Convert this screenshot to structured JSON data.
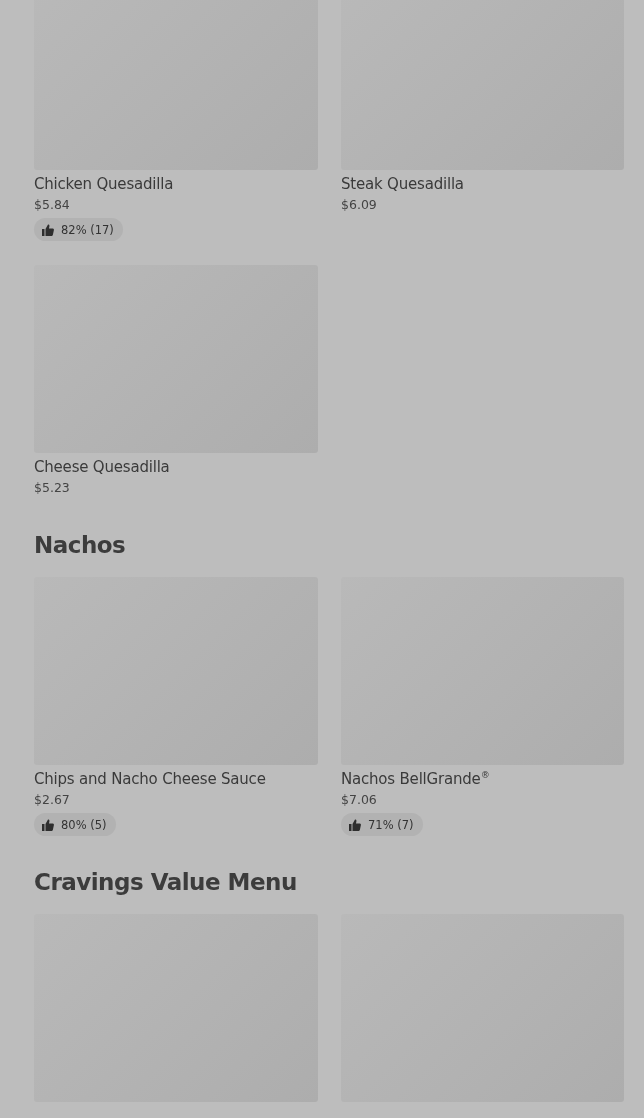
{
  "sections": [
    {
      "items": [
        {
          "image": true,
          "name": "Chicken Quesadilla",
          "price": "$5.84",
          "rating": "82% (17)"
        },
        {
          "image": true,
          "name": "Steak Quesadilla",
          "price": "$6.09"
        },
        {
          "image": true,
          "name": "Cheese Quesadilla",
          "price": "$5.23"
        }
      ]
    },
    {
      "title": "Nachos",
      "items": [
        {
          "image": true,
          "name": "Chips and Nacho Cheese Sauce",
          "price": "$2.67",
          "rating": "80% (5)"
        },
        {
          "image": true,
          "name": "Nachos BellGrande$^{®}$",
          "price": "$7.06",
          "rating": "71% (7)"
        }
      ]
    },
    {
      "title": "Cravings Value Menu",
      "items": [
        {
          "image": true
        },
        {
          "image": true
        }
      ]
    }
  ]
}
